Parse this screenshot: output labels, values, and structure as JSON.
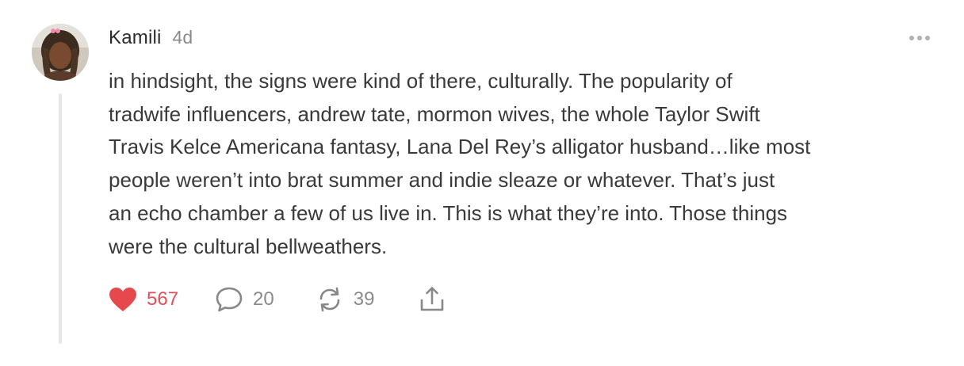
{
  "post": {
    "author": "Kamili",
    "time": "4d",
    "body_lines": [
      "in hindsight, the signs were kind of there, culturally. The popularity of",
      "tradwife influencers, andrew tate, mormon wives, the whole Taylor Swift",
      "Travis Kelce Americana fantasy, Lana Del Rey’s alligator husband…like most",
      "people weren’t into brat summer and indie sleaze or whatever. That’s just",
      "an echo chamber a few of us live in. This is what they’re into. Those things",
      "were the cultural bellweathers."
    ]
  },
  "actions": {
    "likes": "567",
    "comments": "20",
    "restacks": "39"
  },
  "icons": {
    "like": "heart-icon",
    "comment": "comment-bubble-icon",
    "restack": "restack-icon",
    "share": "share-icon",
    "more": "more-dots-icon"
  },
  "colors": {
    "like": "#e5484d",
    "muted": "#8a8a8a",
    "text": "#3a3a3a",
    "thread_line": "#e6e6e6"
  }
}
